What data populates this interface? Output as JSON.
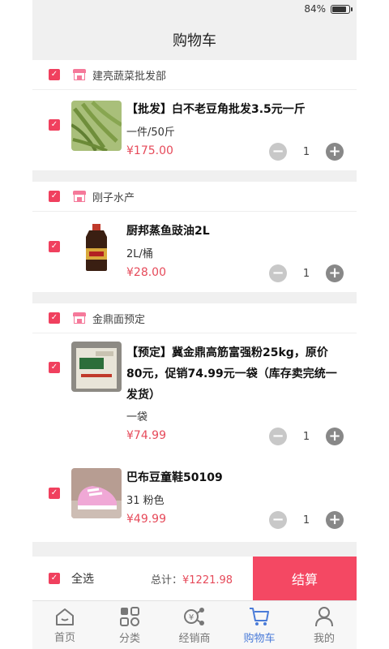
{
  "status": {
    "battery_text": "84%",
    "battery_level": 0.84
  },
  "header": {
    "title": "购物车"
  },
  "stores": [
    {
      "name": "建亮蔬菜批发部",
      "items": [
        {
          "title": "【批发】白不老豆角批发3.5元一斤",
          "spec": "一件/50斤",
          "price": "¥175.00",
          "qty": "1"
        }
      ]
    },
    {
      "name": "刚子水产",
      "items": [
        {
          "title": "厨邦蒸鱼豉油2L",
          "spec": "2L/桶",
          "price": "¥28.00",
          "qty": "1"
        }
      ]
    },
    {
      "name": "金鼎面预定",
      "items": [
        {
          "title": "【预定】冀金鼎高筋富强粉25kg，原价80元，促销74.99元一袋（库存卖完统一发货）",
          "spec": "一袋",
          "price": "¥74.99",
          "qty": "1"
        },
        {
          "title": "巴布豆童鞋50109",
          "spec": "31 粉色",
          "price": "¥49.99",
          "qty": "1"
        }
      ]
    }
  ],
  "bottom": {
    "select_all": "全选",
    "total_label": "总计：",
    "total_value": "¥1221.98",
    "checkout": "结算"
  },
  "tabs": [
    {
      "label": "首页",
      "icon": "home-icon"
    },
    {
      "label": "分类",
      "icon": "category-icon"
    },
    {
      "label": "经销商",
      "icon": "dealer-icon"
    },
    {
      "label": "购物车",
      "icon": "cart-icon",
      "active": true
    },
    {
      "label": "我的",
      "icon": "profile-icon"
    }
  ],
  "colors": {
    "accent": "#f44863",
    "price": "#e64a5a",
    "tab_active": "#4a7bd8"
  }
}
